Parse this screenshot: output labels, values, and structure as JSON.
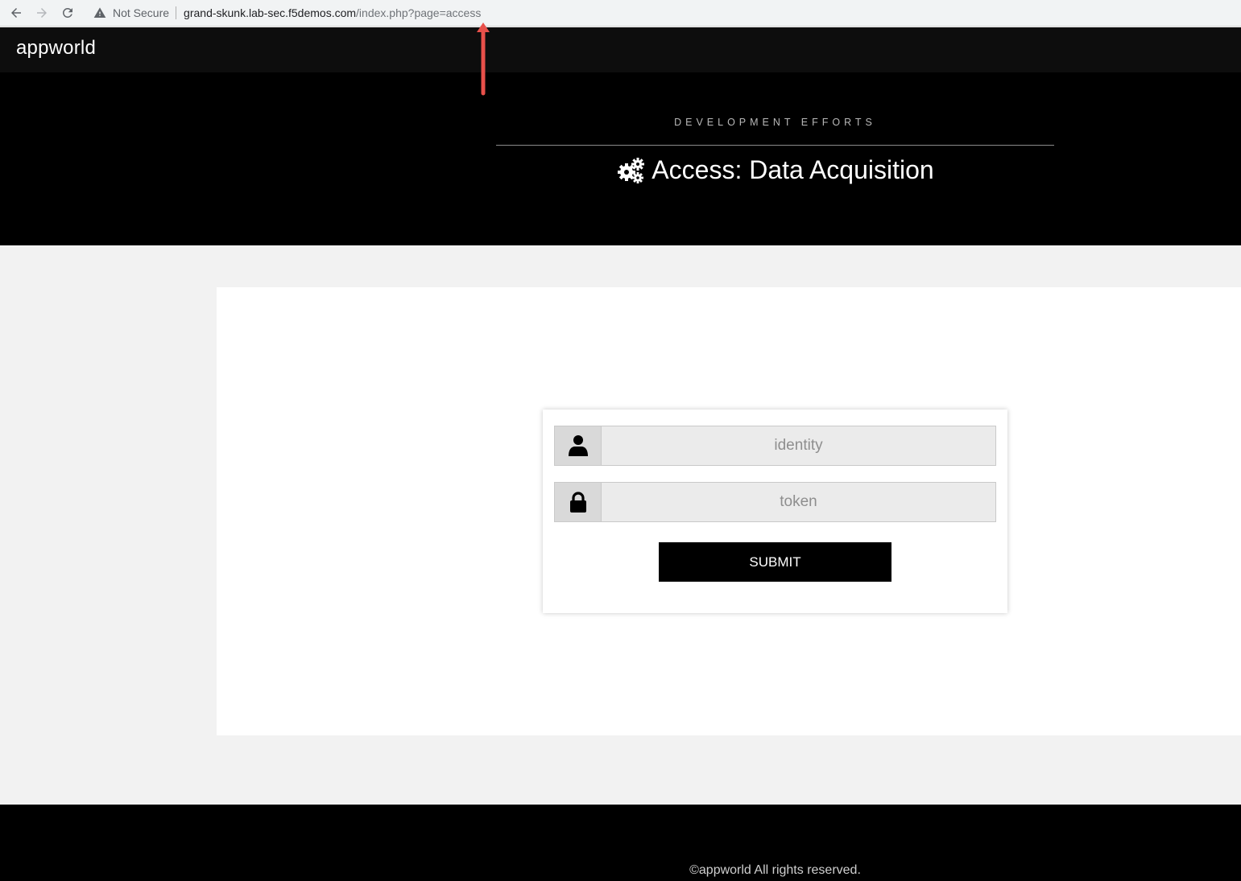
{
  "browser": {
    "security_label": "Not Secure",
    "url_host": "grand-skunk.lab-sec.f5demos.com",
    "url_path": "/index.php?page=access"
  },
  "site": {
    "brand": "appworld"
  },
  "hero": {
    "kicker": "DEVELOPMENT EFFORTS",
    "title": "Access: Data Acquisition"
  },
  "form": {
    "identity_placeholder": "identity",
    "token_placeholder": "token",
    "submit_label": "SUBMIT"
  },
  "footer": {
    "text": "©appworld All rights reserved."
  },
  "colors": {
    "annotation_arrow": "#e8504a",
    "hero_bg": "#000000",
    "panel_bg": "#ffffff"
  }
}
